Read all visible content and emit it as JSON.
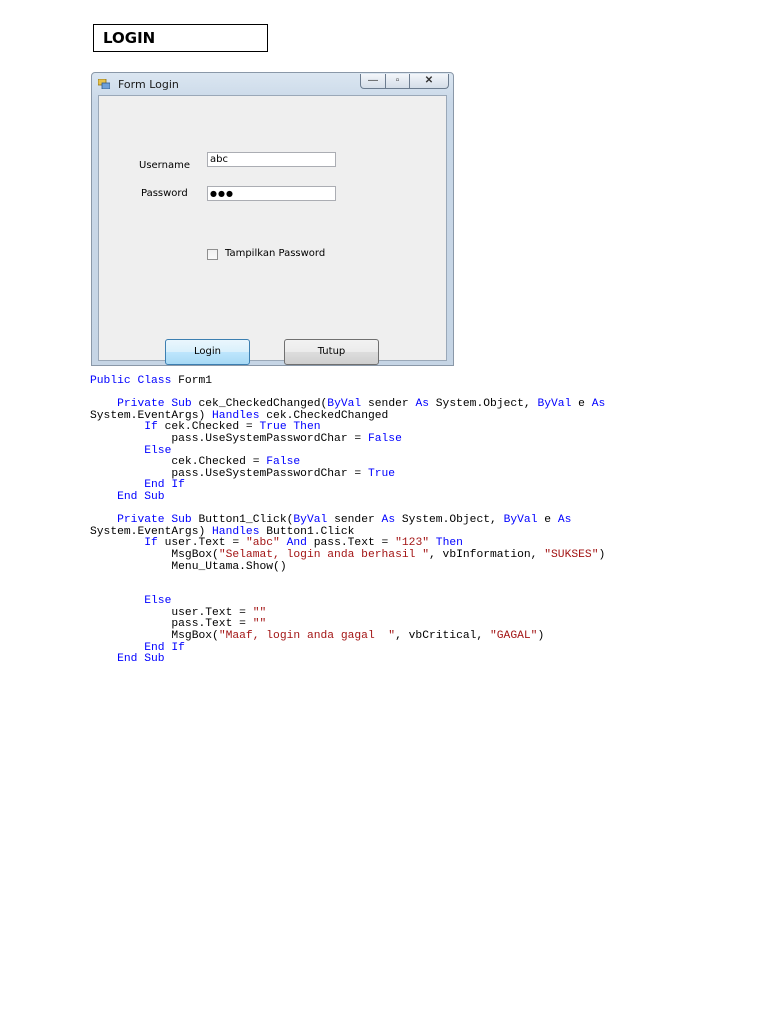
{
  "heading": "LOGIN",
  "window": {
    "title": "Form Login",
    "controls": {
      "minimize": "—",
      "maximize": "▫",
      "close": "✕"
    },
    "username_label": "Username",
    "username_value": "abc",
    "password_label": "Password",
    "password_value": "●●●",
    "show_password_label": "Tampilkan Password",
    "show_password_checked": false,
    "login_button": "Login",
    "close_button": "Tutup"
  },
  "colors": {
    "keyword": "#0000ff",
    "string": "#a31515",
    "text": "#000000"
  },
  "code_lines": [
    [
      [
        "k",
        "Public Class"
      ],
      [
        "t",
        " Form1"
      ]
    ],
    [],
    [
      [
        "t",
        "    "
      ],
      [
        "k",
        "Private Sub"
      ],
      [
        "t",
        " cek_CheckedChanged("
      ],
      [
        "k",
        "ByVal"
      ],
      [
        "t",
        " sender "
      ],
      [
        "k",
        "As"
      ],
      [
        "t",
        " System.Object, "
      ],
      [
        "k",
        "ByVal"
      ],
      [
        "t",
        " e "
      ],
      [
        "k",
        "As"
      ]
    ],
    [
      [
        "t",
        "System.EventArgs) "
      ],
      [
        "k",
        "Handles"
      ],
      [
        "t",
        " cek.CheckedChanged"
      ]
    ],
    [
      [
        "t",
        "        "
      ],
      [
        "k",
        "If"
      ],
      [
        "t",
        " cek.Checked = "
      ],
      [
        "k",
        "True"
      ],
      [
        "t",
        " "
      ],
      [
        "k",
        "Then"
      ]
    ],
    [
      [
        "t",
        "            pass.UseSystemPasswordChar = "
      ],
      [
        "k",
        "False"
      ]
    ],
    [
      [
        "t",
        "        "
      ],
      [
        "k",
        "Else"
      ]
    ],
    [
      [
        "t",
        "            cek.Checked = "
      ],
      [
        "k",
        "False"
      ]
    ],
    [
      [
        "t",
        "            pass.UseSystemPasswordChar = "
      ],
      [
        "k",
        "True"
      ]
    ],
    [
      [
        "t",
        "        "
      ],
      [
        "k",
        "End If"
      ]
    ],
    [
      [
        "t",
        "    "
      ],
      [
        "k",
        "End Sub"
      ]
    ],
    [],
    [
      [
        "t",
        "    "
      ],
      [
        "k",
        "Private Sub"
      ],
      [
        "t",
        " Button1_Click("
      ],
      [
        "k",
        "ByVal"
      ],
      [
        "t",
        " sender "
      ],
      [
        "k",
        "As"
      ],
      [
        "t",
        " System.Object, "
      ],
      [
        "k",
        "ByVal"
      ],
      [
        "t",
        " e "
      ],
      [
        "k",
        "As"
      ]
    ],
    [
      [
        "t",
        "System.EventArgs) "
      ],
      [
        "k",
        "Handles"
      ],
      [
        "t",
        " Button1.Click"
      ]
    ],
    [
      [
        "t",
        "        "
      ],
      [
        "k",
        "If"
      ],
      [
        "t",
        " user.Text = "
      ],
      [
        "s",
        "\"abc\""
      ],
      [
        "t",
        " "
      ],
      [
        "k",
        "And"
      ],
      [
        "t",
        " pass.Text = "
      ],
      [
        "s",
        "\"123\""
      ],
      [
        "t",
        " "
      ],
      [
        "k",
        "Then"
      ]
    ],
    [
      [
        "t",
        "            MsgBox("
      ],
      [
        "s",
        "\"Selamat, login anda berhasil \""
      ],
      [
        "t",
        ", vbInformation, "
      ],
      [
        "s",
        "\"SUKSES\""
      ],
      [
        "t",
        ")"
      ]
    ],
    [
      [
        "t",
        "            Menu_Utama.Show()"
      ]
    ],
    [],
    [],
    [
      [
        "t",
        "        "
      ],
      [
        "k",
        "Else"
      ]
    ],
    [
      [
        "t",
        "            user.Text = "
      ],
      [
        "s",
        "\"\""
      ]
    ],
    [
      [
        "t",
        "            pass.Text = "
      ],
      [
        "s",
        "\"\""
      ]
    ],
    [
      [
        "t",
        "            MsgBox("
      ],
      [
        "s",
        "\"Maaf, login anda gagal  \""
      ],
      [
        "t",
        ", vbCritical, "
      ],
      [
        "s",
        "\"GAGAL\""
      ],
      [
        "t",
        ")"
      ]
    ],
    [
      [
        "t",
        "        "
      ],
      [
        "k",
        "End If"
      ]
    ],
    [
      [
        "t",
        "    "
      ],
      [
        "k",
        "End Sub"
      ]
    ]
  ]
}
